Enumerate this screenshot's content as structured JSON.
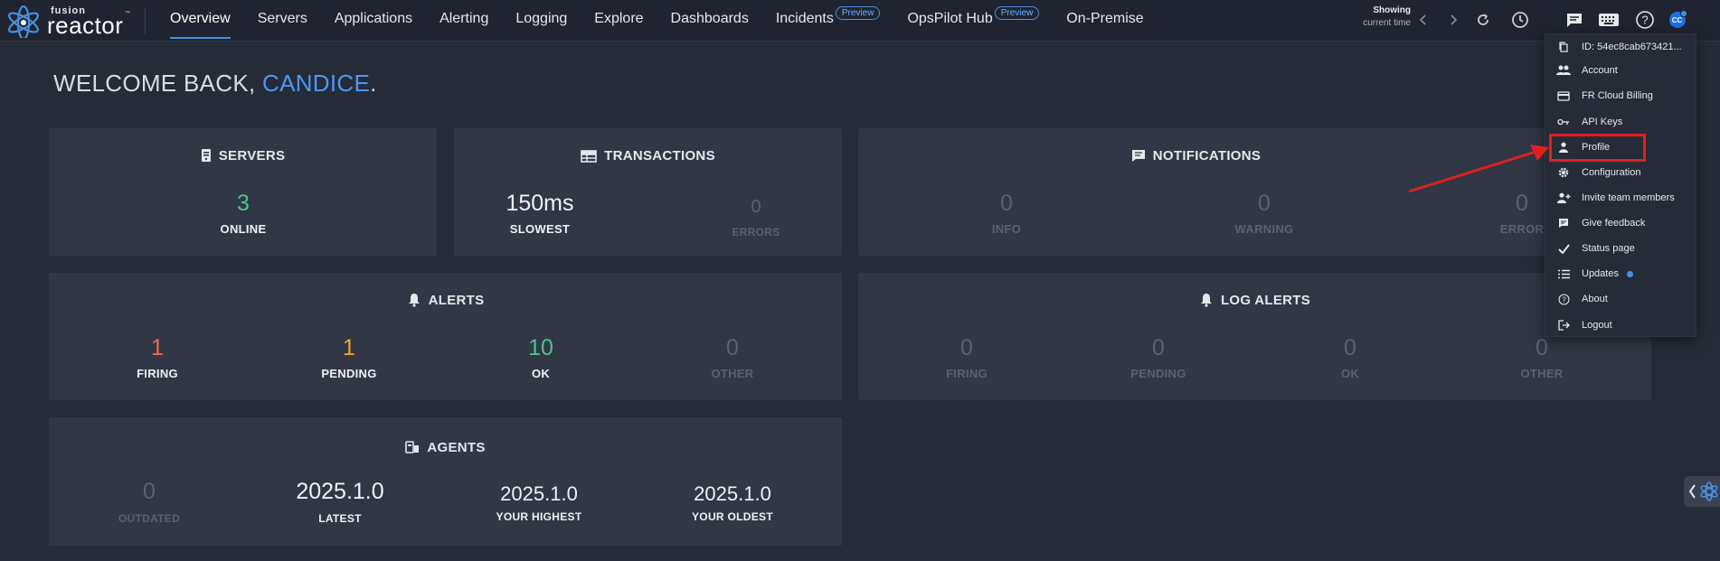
{
  "brand": {
    "line1": "fusion",
    "line2": "reactor",
    "tm": "™"
  },
  "nav": [
    {
      "label": "Overview",
      "active": true
    },
    {
      "label": "Servers"
    },
    {
      "label": "Applications"
    },
    {
      "label": "Alerting"
    },
    {
      "label": "Logging"
    },
    {
      "label": "Explore"
    },
    {
      "label": "Dashboards"
    },
    {
      "label": "Incidents",
      "badge": "Preview"
    },
    {
      "label": "OpsPilot Hub",
      "badge": "Preview"
    },
    {
      "label": "On-Premise"
    }
  ],
  "time_range": {
    "line1": "Showing",
    "line2": "current time"
  },
  "avatar": {
    "initials": "CC"
  },
  "welcome": {
    "prefix": "WELCOME BACK, ",
    "name": "CANDICE",
    "suffix": "."
  },
  "servers": {
    "title": "SERVERS",
    "value": "3",
    "label": "ONLINE"
  },
  "transactions": {
    "title": "TRANSACTIONS",
    "slowest_value": "150ms",
    "slowest_label": "SLOWEST",
    "errors_value": "0",
    "errors_label": "ERRORS"
  },
  "notifications": {
    "title": "NOTIFICATIONS",
    "info_value": "0",
    "info_label": "INFO",
    "warning_value": "0",
    "warning_label": "WARNING",
    "error_value": "0",
    "error_label": "ERROR"
  },
  "alerts": {
    "title": "ALERTS",
    "firing_value": "1",
    "firing_label": "FIRING",
    "pending_value": "1",
    "pending_label": "PENDING",
    "ok_value": "10",
    "ok_label": "OK",
    "other_value": "0",
    "other_label": "OTHER"
  },
  "log_alerts": {
    "title": "LOG ALERTS",
    "firing_value": "0",
    "firing_label": "FIRING",
    "pending_value": "0",
    "pending_label": "PENDING",
    "ok_value": "0",
    "ok_label": "OK",
    "other_value": "0",
    "other_label": "OTHER"
  },
  "agents": {
    "title": "AGENTS",
    "outdated_value": "0",
    "outdated_label": "OUTDATED",
    "latest_value": "2025.1.0",
    "latest_label": "LATEST",
    "highest_value": "2025.1.0",
    "highest_label": "YOUR HIGHEST",
    "oldest_value": "2025.1.0",
    "oldest_label": "YOUR OLDEST"
  },
  "menu": [
    {
      "label": "ID: 54ec8cab673421...",
      "icon": "copy-icon"
    },
    {
      "label": "Account",
      "icon": "people-icon"
    },
    {
      "label": "FR Cloud Billing",
      "icon": "credit-card-icon"
    },
    {
      "label": "API Keys",
      "icon": "key-icon"
    },
    {
      "label": "Profile",
      "icon": "person-icon"
    },
    {
      "label": "Configuration",
      "icon": "gear-icon"
    },
    {
      "label": "Invite team members",
      "icon": "person-add-icon"
    },
    {
      "label": "Give feedback",
      "icon": "feedback-icon"
    },
    {
      "label": "Status page",
      "icon": "check-icon"
    },
    {
      "label": "Updates",
      "icon": "list-icon",
      "dot": true
    },
    {
      "label": "About",
      "icon": "question-icon"
    },
    {
      "label": "Logout",
      "icon": "logout-icon"
    }
  ],
  "colors": {
    "accent": "#4a90e2",
    "ok": "#4fc28c",
    "firing": "#f0684d",
    "pending": "#f3a531",
    "annotation": "#e02020"
  }
}
